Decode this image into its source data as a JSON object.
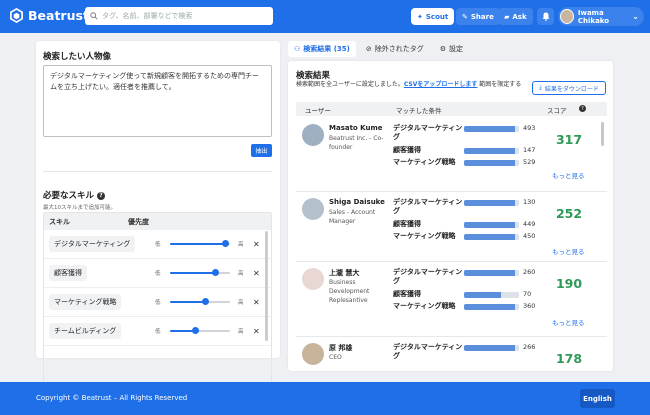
{
  "header": {
    "app_name": "Beatrust",
    "search_placeholder": "タグ、名前、部署などで検索",
    "scout_label": "Scout",
    "share_label": "Share",
    "ask_label": "Ask",
    "user_name": "Iwama Chikako",
    "brand_color": "#1f6fe8"
  },
  "persona": {
    "title": "検索したい人物像",
    "text": "デジタルマーケティング使って新規顧客を開拓するための専門チームを立ち上げたい。適任者を推薦して。",
    "extract_label": "抽出"
  },
  "skills": {
    "title": "必要なスキル",
    "hint": "最大10スキルまで追加可能。",
    "col_skill": "スキル",
    "col_priority": "優先度",
    "low_label": "低",
    "high_label": "高",
    "rows": [
      {
        "name": "デジタルマーケティング",
        "priority": 0.92
      },
      {
        "name": "顧客獲得",
        "priority": 0.75
      },
      {
        "name": "マーケティング戦略",
        "priority": 0.58
      },
      {
        "name": "チームビルディング",
        "priority": 0.42
      }
    ]
  },
  "tabs": [
    {
      "label": "検索結果 (35)",
      "active": true
    },
    {
      "label": "除外されたタグ",
      "active": false
    },
    {
      "label": "設定",
      "active": false
    }
  ],
  "results": {
    "title": "検索結果",
    "desc_before": "検索範囲を全ユーザーに設定しました。",
    "desc_link": "CSVをアップロードします",
    "desc_after": "範囲を限定する",
    "download_label": "結果をダウンロード",
    "col_user": "ユーザー",
    "col_match": "マッチした条件",
    "col_score": "スコア",
    "more_label": "もっと見る",
    "people": [
      {
        "name": "Masato Kume",
        "org": "Beatrust Inc. - Co-founder",
        "score": "317",
        "matches": [
          {
            "label": "デジタルマーケティング",
            "value": "493",
            "pct": 0.93
          },
          {
            "label": "顧客獲得",
            "value": "147",
            "pct": 0.93
          },
          {
            "label": "マーケティング戦略",
            "value": "529",
            "pct": 0.93
          }
        ]
      },
      {
        "name": "Shiga Daisuke",
        "org": "Sales - Account Manager",
        "score": "252",
        "matches": [
          {
            "label": "デジタルマーケティング",
            "value": "130",
            "pct": 0.93
          },
          {
            "label": "顧客獲得",
            "value": "449",
            "pct": 0.93
          },
          {
            "label": "マーケティング戦略",
            "value": "450",
            "pct": 0.93
          }
        ]
      },
      {
        "name": "上瀧 慧大",
        "org": "Business Development Replesantive",
        "score": "190",
        "matches": [
          {
            "label": "デジタルマーケティング",
            "value": "260",
            "pct": 0.93
          },
          {
            "label": "顧客獲得",
            "value": "70",
            "pct": 0.68
          },
          {
            "label": "マーケティング戦略",
            "value": "360",
            "pct": 0.93
          }
        ]
      },
      {
        "name": "原 邦雄",
        "org": "CEO",
        "score": "178",
        "matches": [
          {
            "label": "デジタルマーケティング",
            "value": "266",
            "pct": 0.93
          }
        ]
      }
    ]
  },
  "footer": {
    "copyright": "Copyright © Beatrust – All Rights Reserved",
    "language": "English"
  }
}
